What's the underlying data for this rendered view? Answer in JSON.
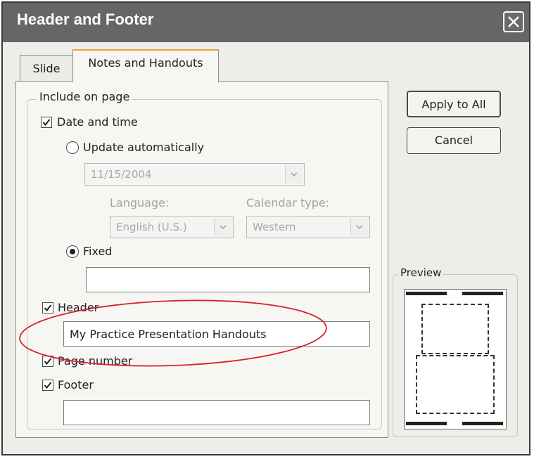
{
  "window": {
    "title": "Header and Footer"
  },
  "tabs": [
    {
      "label": "Slide",
      "selected": false
    },
    {
      "label": "Notes and Handouts",
      "selected": true
    }
  ],
  "include_group": {
    "legend": "Include on page",
    "date_time": {
      "label": "Date and time",
      "checked": true,
      "update_automatically": {
        "label": "Update automatically",
        "selected": false,
        "date_value": "11/15/2004",
        "language_label": "Language:",
        "language_value": "English (U.S.)",
        "calendar_label": "Calendar type:",
        "calendar_value": "Western"
      },
      "fixed": {
        "label": "Fixed",
        "selected": true,
        "value": ""
      }
    },
    "header": {
      "label": "Header",
      "checked": true,
      "value": "My Practice Presentation Handouts"
    },
    "page_number": {
      "label": "Page number",
      "checked": true
    },
    "footer": {
      "label": "Footer",
      "checked": true,
      "value": ""
    }
  },
  "buttons": {
    "apply_to_all": "Apply to All",
    "cancel": "Cancel"
  },
  "preview": {
    "legend": "Preview"
  },
  "colors": {
    "title_bar": "#666666",
    "dialog_bg": "#eeede7",
    "annotation_ellipse": "#d9202a"
  }
}
